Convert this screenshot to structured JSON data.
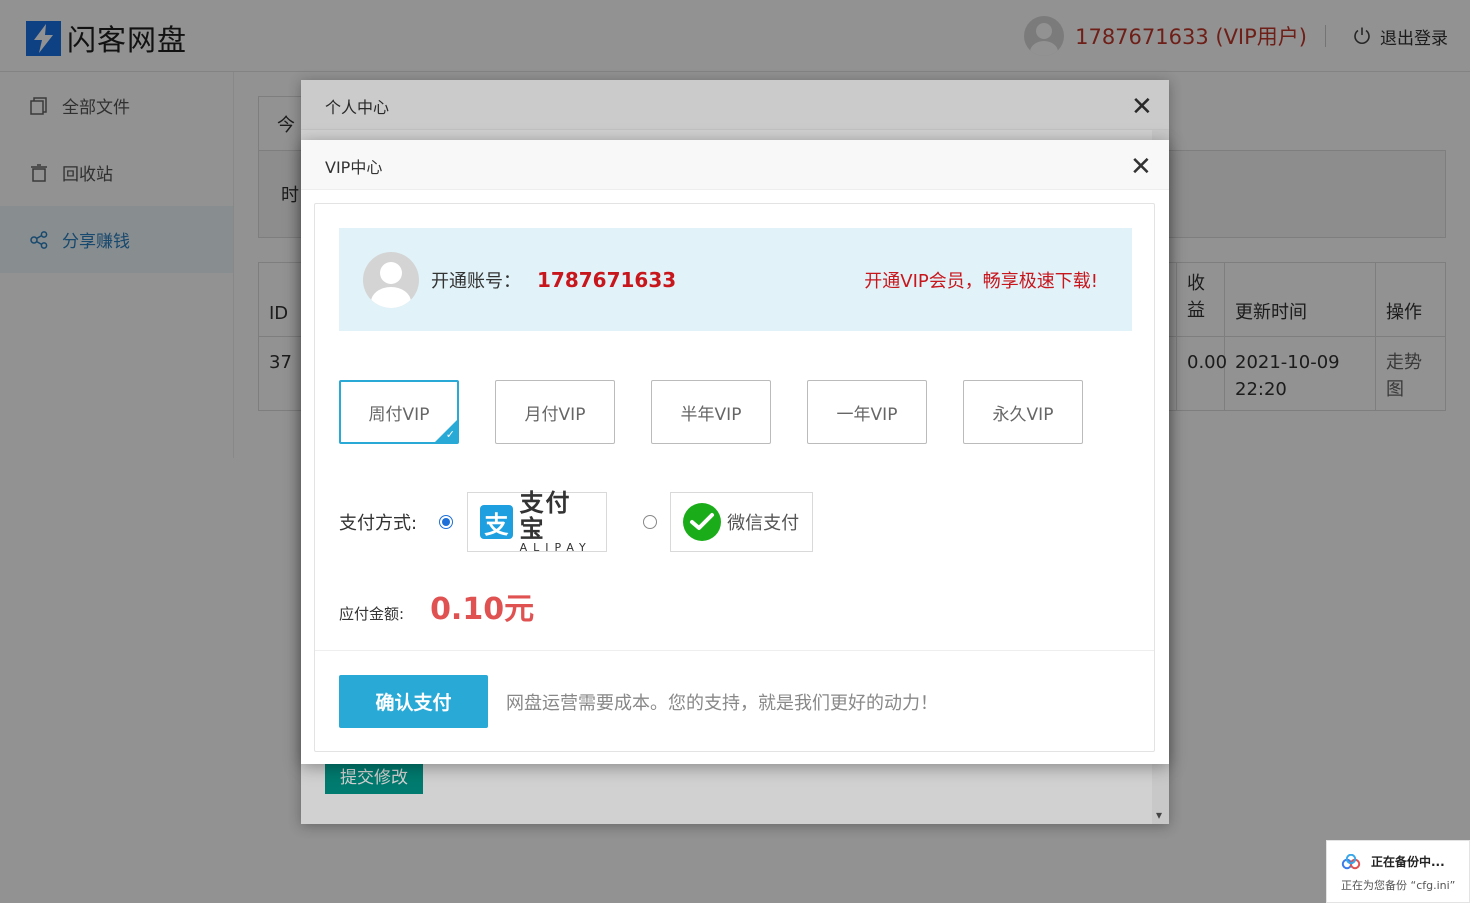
{
  "header": {
    "logo_text": "闪客网盘",
    "user_label": "1787671633 (VIP用户)",
    "logout_label": "退出登录"
  },
  "sidebar": {
    "items": [
      {
        "label": "全部文件"
      },
      {
        "label": "回收站"
      },
      {
        "label": "分享赚钱"
      }
    ]
  },
  "main": {
    "tab_label": "今",
    "filter_text": "时",
    "table": {
      "headers": [
        "ID",
        "收\n益",
        "更新时间",
        "操作"
      ],
      "rows": [
        {
          "id": "37",
          "income": "0.00",
          "updated": "2021-10-09\n22:20",
          "action": "走势\n图"
        }
      ]
    }
  },
  "personal_center": {
    "title": "个人中心",
    "submit_label": "提交修改"
  },
  "vip": {
    "title": "VIP中心",
    "account_label": "开通账号：",
    "account_number": "1787671633",
    "promo": "开通VIP会员，畅享极速下载!",
    "plans": [
      {
        "label": "周付VIP",
        "selected": true
      },
      {
        "label": "月付VIP",
        "selected": false
      },
      {
        "label": "半年VIP",
        "selected": false
      },
      {
        "label": "一年VIP",
        "selected": false
      },
      {
        "label": "永久VIP",
        "selected": false
      }
    ],
    "payment_label": "支付方式:",
    "alipay_cn": "支付宝",
    "alipay_en": "ALIPAY",
    "alipay_glyph": "支",
    "wechat_label": "微信支付",
    "amount_label": "应付金额:",
    "amount": "0.10元",
    "confirm_label": "确认支付",
    "support_text": "网盘运营需要成本。您的支持，就是我们更好的动力！"
  },
  "toast": {
    "title": "正在备份中...",
    "subtitle": "正在为您备份 “cfg.ini”"
  },
  "colors": {
    "accent": "#29a9d6",
    "vip_red": "#c8161d",
    "amount_red": "#e05252",
    "submit_green": "#009688"
  }
}
